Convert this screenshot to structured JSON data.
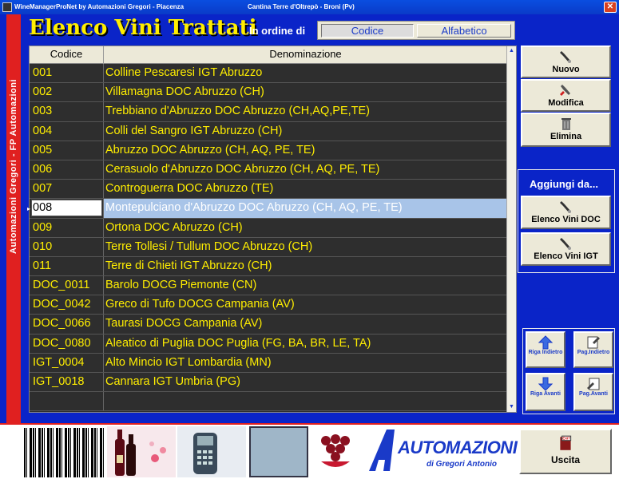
{
  "window": {
    "title_left": "WineManagerProNet by Automazioni Gregori - Piacenza",
    "title_center": "Cantina Terre d'Oltrepò - Broni (Pv)",
    "close_label": "✕"
  },
  "sidebar": {
    "vertical_text": "Automazioni Gregori - FP Automazioni"
  },
  "header": {
    "title": "Elenco Vini Trattati",
    "order_label": "In ordine di",
    "order_options": [
      "Codice",
      "Alfabetico"
    ],
    "order_selected": "Codice"
  },
  "table": {
    "columns": [
      "Codice",
      "Denominazione"
    ],
    "selected_index": 7,
    "rows": [
      {
        "code": "001",
        "name": "Colline Pescaresi IGT Abruzzo"
      },
      {
        "code": "002",
        "name": "Villamagna DOC Abruzzo (CH)"
      },
      {
        "code": "003",
        "name": "Trebbiano d'Abruzzo DOC Abruzzo (CH,AQ,PE,TE)"
      },
      {
        "code": "004",
        "name": "Colli del Sangro IGT Abruzzo (CH)"
      },
      {
        "code": "005",
        "name": "Abruzzo DOC Abruzzo (CH, AQ, PE, TE)"
      },
      {
        "code": "006",
        "name": "Cerasuolo d'Abruzzo DOC Abruzzo (CH, AQ, PE, TE)"
      },
      {
        "code": "007",
        "name": "Controguerra DOC Abruzzo (TE)"
      },
      {
        "code": "008",
        "name": "Montepulciano d'Abruzzo DOC Abruzzo (CH, AQ, PE, TE)"
      },
      {
        "code": "009",
        "name": "Ortona DOC Abruzzo (CH)"
      },
      {
        "code": "010",
        "name": "Terre Tollesi / Tullum DOC Abruzzo (CH)"
      },
      {
        "code": "011",
        "name": "Terre di Chieti IGT Abruzzo (CH)"
      },
      {
        "code": "DOC_0011",
        "name": "Barolo DOCG Piemonte (CN)"
      },
      {
        "code": "DOC_0042",
        "name": "Greco di Tufo DOCG Campania (AV)"
      },
      {
        "code": "DOC_0066",
        "name": "Taurasi DOCG Campania (AV)"
      },
      {
        "code": "DOC_0080",
        "name": "Aleatico di Puglia DOC Puglia (FG, BA, BR, LE, TA)"
      },
      {
        "code": "IGT_0004",
        "name": "Alto Mincio IGT Lombardia (MN)"
      },
      {
        "code": "IGT_0018",
        "name": "Cannara IGT Umbria (PG)"
      },
      {
        "code": "",
        "name": ""
      }
    ]
  },
  "actions": {
    "nuovo": "Nuovo",
    "modifica": "Modifica",
    "elimina": "Elimina"
  },
  "aggiungi": {
    "title": "Aggiungi da...",
    "doc": "Elenco Vini DOC",
    "igt": "Elenco Vini IGT"
  },
  "navigation": {
    "riga_indietro": "Riga Indietro",
    "pag_indietro": "Pag.Indietro",
    "riga_avanti": "Riga Avanti",
    "pag_avanti": "Pag.Avanti"
  },
  "footer": {
    "logo_big": "AUTOMAZIONI",
    "logo_small": "di Gregori Antonio",
    "uscita": "Uscita",
    "exit_icon_text": "EXIT"
  },
  "colors": {
    "background": "#0a24c8",
    "row_text": "#ffee00",
    "selection": "#a8c4e8",
    "accent_red": "#e02020"
  }
}
